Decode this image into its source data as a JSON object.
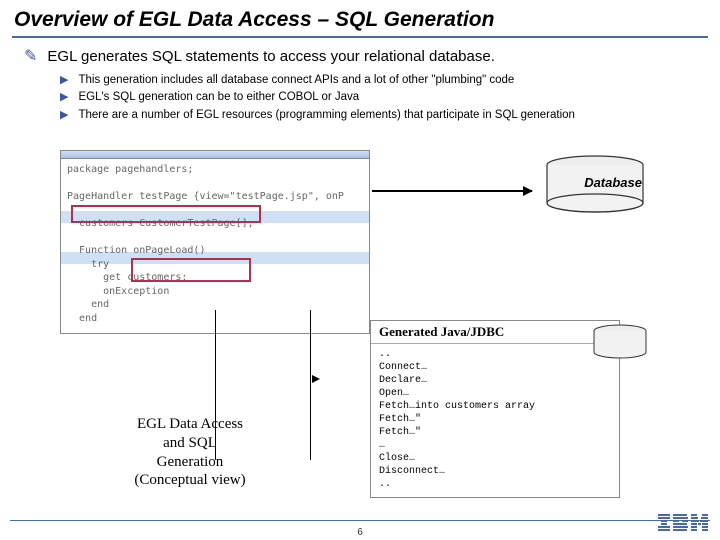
{
  "title": "Overview of EGL Data Access – SQL Generation",
  "mainBullet": "EGL generates SQL statements to access your relational database.",
  "subBullets": {
    "b0": "This generation includes all database connect APIs and a lot of other \"plumbing\" code",
    "b1": "EGL's SQL generation can be to either COBOL or Java",
    "b2": "There are a number of EGL resources (programming elements) that participate in SQL generation"
  },
  "code": {
    "line1": "package pagehandlers;",
    "line2": "PageHandler testPage {view=\"testPage.jsp\", onP",
    "line3": "  customers CustomerTestPage[];",
    "line4": "  Function onPageLoad()",
    "line5": "    try",
    "line6": "      get customers;",
    "line7": "      onException",
    "line8": "    end",
    "line9": "  end"
  },
  "dbLabel": "Database",
  "caption": {
    "l1": "EGL Data Access",
    "l2": "and SQL",
    "l3": "Generation",
    "l4": "(Conceptual view)"
  },
  "gen": {
    "title": "Generated Java/JDBC",
    "body": "..\nConnect…\nDeclare…\nOpen…\nFetch…into customers array\nFetch…\"\nFetch…\"\n…\nClose…\nDisconnect…\n.."
  },
  "pageNumber": "6",
  "logoAlt": "IBM"
}
